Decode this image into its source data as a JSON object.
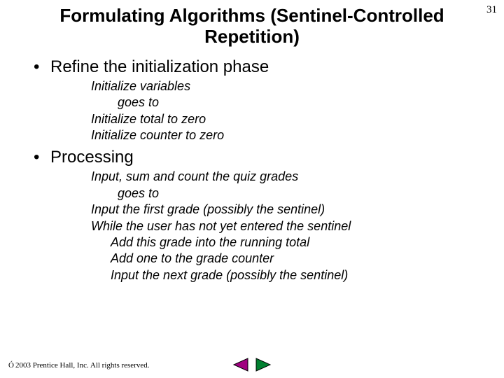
{
  "page_number": "31",
  "title": "Formulating Algorithms (Sentinel-Controlled Repetition)",
  "bullets": [
    {
      "label": "Refine the initialization phase",
      "lines": [
        {
          "text": "Initialize variables",
          "indent": 0
        },
        {
          "text": "goes to",
          "indent": 1
        },
        {
          "text": "Initialize total to zero",
          "indent": 0
        },
        {
          "text": "Initialize counter to zero",
          "indent": 0
        }
      ]
    },
    {
      "label": "Processing",
      "lines": [
        {
          "text": "Input, sum and count the quiz grades",
          "indent": 0
        },
        {
          "text": "goes to",
          "indent": 1
        },
        {
          "text": "Input the first grade (possibly the sentinel)",
          "indent": 0
        },
        {
          "text": "While the user has not yet entered the sentinel",
          "indent": 0
        },
        {
          "text": "Add this grade into the running total",
          "indent": 2
        },
        {
          "text": "Add one to the grade counter",
          "indent": 2
        },
        {
          "text": "Input the next grade (possibly the sentinel)",
          "indent": 2
        }
      ]
    }
  ],
  "footer": {
    "symbol": "Ó",
    "text": " 2003 Prentice Hall, Inc. All rights reserved."
  },
  "nav": {
    "prev_color": "#a00080",
    "next_color": "#008030"
  }
}
